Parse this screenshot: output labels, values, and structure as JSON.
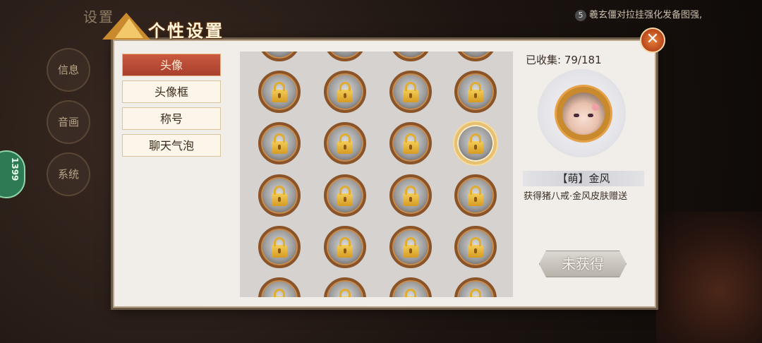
{
  "background": {
    "title": "设置",
    "tip_number": "5",
    "tip_text": "羲玄僵对拉挂强化发备图强,",
    "side_tabs": [
      "信息",
      "音画",
      "系统"
    ],
    "pill_text": "1399"
  },
  "dialog": {
    "title": "个性设置",
    "close_icon": "close-icon"
  },
  "menu": {
    "items": [
      {
        "label": "头像",
        "active": true
      },
      {
        "label": "头像框",
        "active": false
      },
      {
        "label": "称号",
        "active": false
      },
      {
        "label": "聊天气泡",
        "active": false
      }
    ]
  },
  "grid": {
    "columns": 4,
    "visible_rows": 6,
    "items_locked": true,
    "selected": {
      "row": 3,
      "col": 4
    }
  },
  "detail": {
    "collected_label": "已收集:",
    "collected_value": "79/181",
    "name": "【萌】金风",
    "description": "获得猪八戒·金风皮肤赠送",
    "action_button": "未获得"
  }
}
